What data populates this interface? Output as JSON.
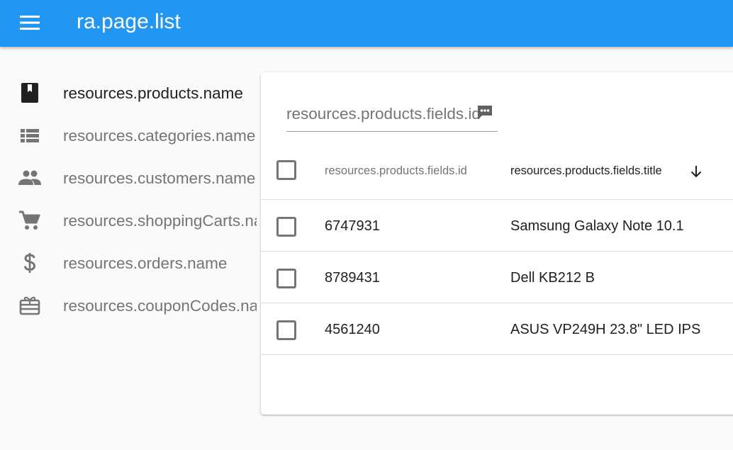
{
  "appbar": {
    "title": "ra.page.list",
    "menu_icon": "menu-icon",
    "background": "#2196f3"
  },
  "sidebar": {
    "items": [
      {
        "label": "resources.products.name",
        "icon": "bookmark-icon",
        "active": true
      },
      {
        "label": "resources.categories.name",
        "icon": "view-list-icon",
        "active": false
      },
      {
        "label": "resources.customers.name",
        "icon": "people-icon",
        "active": false
      },
      {
        "label": "resources.shoppingCarts.name",
        "icon": "shopping-cart-icon",
        "active": false
      },
      {
        "label": "resources.orders.name",
        "icon": "dollar-icon",
        "active": false
      },
      {
        "label": "resources.couponCodes.name",
        "icon": "card-giftcard-icon",
        "active": false
      }
    ]
  },
  "filter": {
    "label": "resources.products.fields.id",
    "icon": "comment-icon"
  },
  "table": {
    "columns": [
      {
        "label": "resources.products.fields.id",
        "sorted": false
      },
      {
        "label": "resources.products.fields.title",
        "sorted": true,
        "sort_icon": "arrow-downward-icon"
      }
    ],
    "rows": [
      {
        "id": "6747931",
        "title": "Samsung Galaxy Note 10.1"
      },
      {
        "id": "8789431",
        "title": "Dell KB212 B"
      },
      {
        "id": "4561240",
        "title": "ASUS VP249H 23.8\" LED IPS"
      }
    ]
  }
}
